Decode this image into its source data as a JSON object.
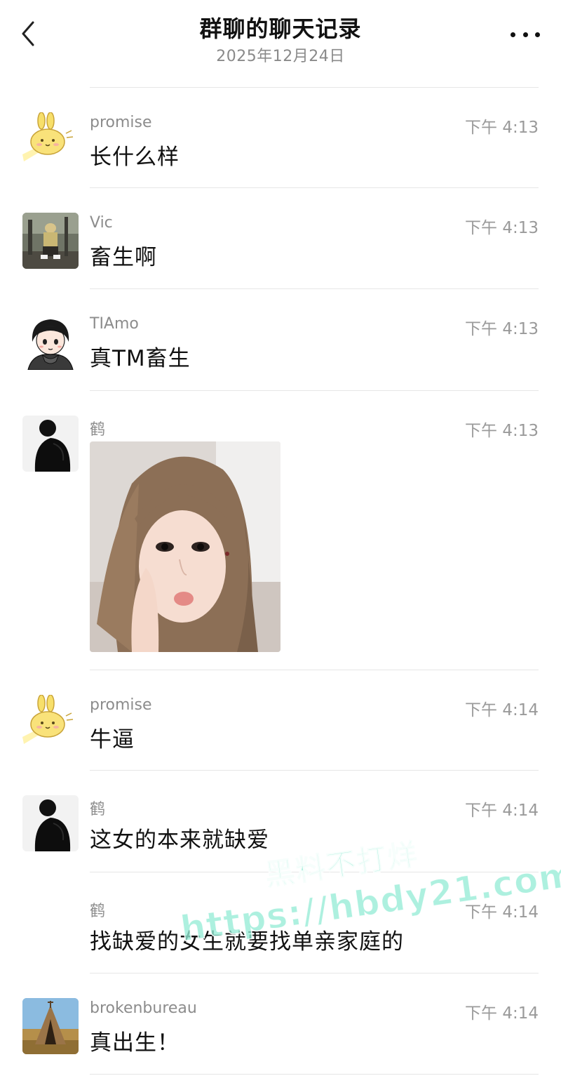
{
  "header": {
    "title": "群聊的聊天记录",
    "date": "2025年12月24日",
    "back_icon": "chevron-left-icon",
    "more_icon": "more-horizontal-icon"
  },
  "messages": [
    {
      "sender": "promise",
      "time": "下午 4:13",
      "text": "长什么样",
      "avatar": "bunny-avatar"
    },
    {
      "sender": "Vic",
      "time": "下午 4:13",
      "text": "畜生啊",
      "avatar": "photo-avatar"
    },
    {
      "sender": "TIAmo",
      "time": "下午 4:13",
      "text": "真TM畜生",
      "avatar": "cartoon-boy-avatar"
    },
    {
      "sender": "鹤",
      "time": "下午 4:13",
      "text": "",
      "avatar": "dark-figure-avatar",
      "image": "selfie-photo"
    },
    {
      "sender": "promise",
      "time": "下午 4:14",
      "text": "牛逼",
      "avatar": "bunny-avatar"
    },
    {
      "sender": "鹤",
      "time": "下午 4:14",
      "text": "这女的本来就缺爱",
      "avatar": "dark-figure-avatar"
    },
    {
      "sender": "鹤",
      "time": "下午 4:14",
      "text": "找缺爱的女生就要找单亲家庭的",
      "avatar": ""
    },
    {
      "sender": "brokenbureau",
      "time": "下午 4:14",
      "text": "真出生！",
      "avatar": "tent-photo-avatar"
    }
  ],
  "watermark": {
    "line1": "黑料不打烊",
    "line2": "https://hbdy21.com"
  },
  "colors": {
    "background": "#ffffff",
    "sender": "#8c8c8c",
    "time": "#9a9a9a",
    "divider": "#e6e6e6",
    "watermark": "#96ecd6"
  }
}
